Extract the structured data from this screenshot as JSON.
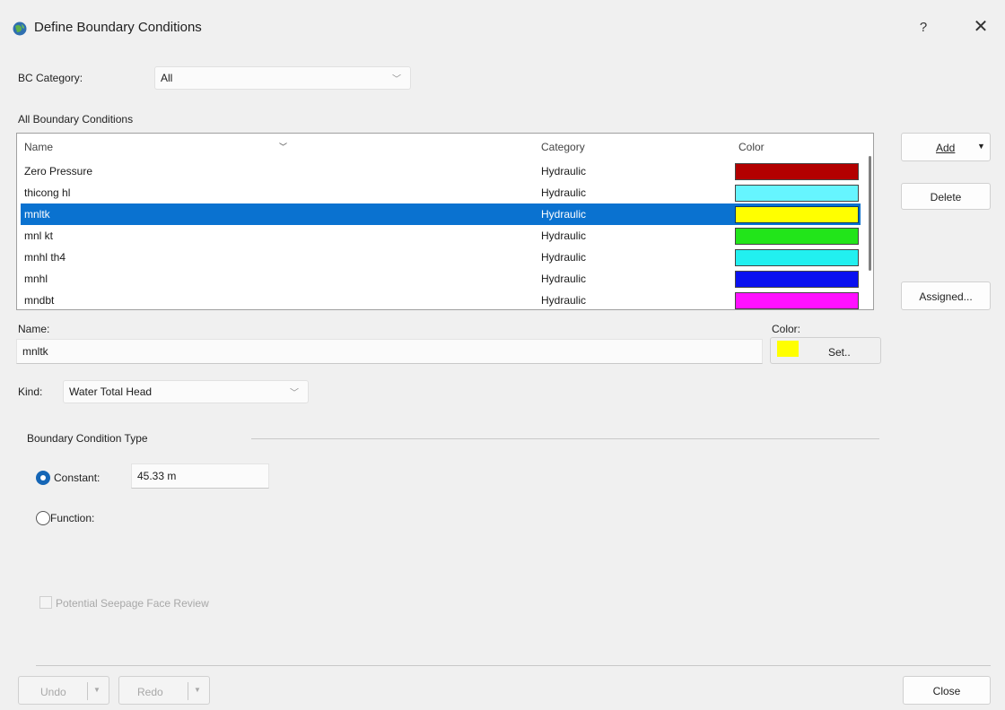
{
  "window": {
    "title": "Define Boundary Conditions",
    "help": "?",
    "close": "✕"
  },
  "bc_category": {
    "label": "BC Category:",
    "value": "All"
  },
  "list": {
    "heading": "All Boundary Conditions",
    "columns": {
      "name": "Name",
      "category": "Category",
      "color": "Color"
    },
    "rows": [
      {
        "name": "Zero Pressure",
        "category": "Hydraulic",
        "color": "#b30000"
      },
      {
        "name": "thicong hl",
        "category": "Hydraulic",
        "color": "#66f5ff"
      },
      {
        "name": "mnltk",
        "category": "Hydraulic",
        "color": "#ffff00"
      },
      {
        "name": "mnl kt",
        "category": "Hydraulic",
        "color": "#22e51a"
      },
      {
        "name": "mnhl th4",
        "category": "Hydraulic",
        "color": "#22f0f0"
      },
      {
        "name": "mnhl",
        "category": "Hydraulic",
        "color": "#0a10f0"
      },
      {
        "name": "mndbt",
        "category": "Hydraulic",
        "color": "#ff10ff"
      }
    ],
    "selected_index": 2
  },
  "buttons": {
    "add": "Add",
    "delete": "Delete",
    "assigned": "Assigned...",
    "set": "Set..",
    "undo": "Undo",
    "redo": "Redo",
    "close": "Close"
  },
  "name_field": {
    "label": "Name:",
    "value": "mnltk"
  },
  "color_field": {
    "label": "Color:",
    "value": "#ffff00"
  },
  "kind": {
    "label": "Kind:",
    "value": "Water Total Head"
  },
  "bc_type": {
    "heading": "Boundary Condition Type",
    "constant_label": "Constant:",
    "constant_value": "45.33 m",
    "function_label": "Function:"
  },
  "seepage": {
    "label": "Potential Seepage Face Review",
    "checked": false
  }
}
